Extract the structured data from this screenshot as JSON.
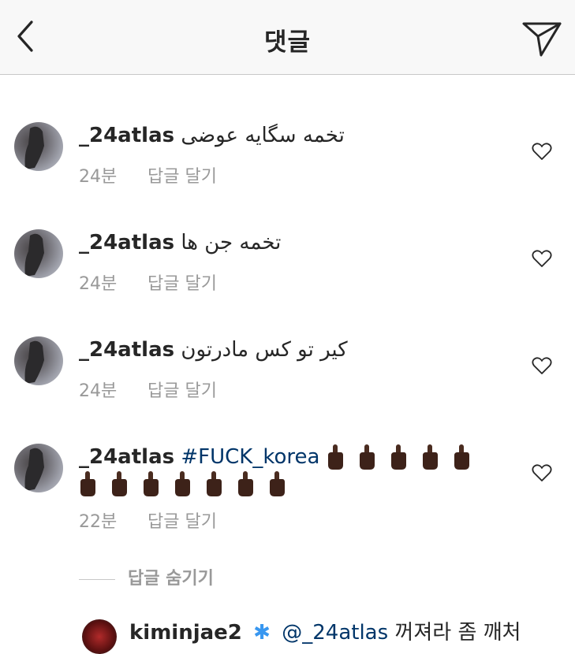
{
  "header": {
    "title": "댓글"
  },
  "comments": [
    {
      "username": "_24atlas",
      "text": "تخمه سگایه عوضی",
      "time": "24분",
      "reply_label": "답글 달기"
    },
    {
      "username": "_24atlas",
      "text": "تخمه جن ها",
      "time": "24분",
      "reply_label": "답글 달기"
    },
    {
      "username": "_24atlas",
      "text": "کیر تو کس مادرتون",
      "time": "24분",
      "reply_label": "답글 달기"
    },
    {
      "username": "_24atlas",
      "hashtag": "#FUCK_korea",
      "emoji_count": 12,
      "time": "22분",
      "reply_label": "답글 달기"
    }
  ],
  "replies": {
    "hide_label": "답글 숨기기"
  },
  "partial_reply": {
    "username": "kiminjae2",
    "mention": "@_24atlas",
    "text": "꺼져라 좀 깨처"
  },
  "icons": {
    "back": "chevron-left-icon",
    "send": "paper-plane-icon",
    "like": "heart-outline-icon"
  }
}
